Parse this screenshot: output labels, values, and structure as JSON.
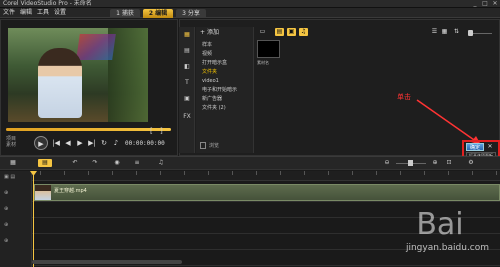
{
  "window": {
    "title": "Corel VideoStudio Pro - 未命名",
    "controls": [
      "_",
      "□",
      "✕"
    ]
  },
  "menu": [
    {
      "label": "文件"
    },
    {
      "label": "编辑"
    },
    {
      "label": "工具"
    },
    {
      "label": "设置"
    }
  ],
  "steps": [
    {
      "label": "1 捕获",
      "active": false
    },
    {
      "label": "2 编辑",
      "active": true
    },
    {
      "label": "3 分享",
      "active": false
    }
  ],
  "preview": {
    "project_label": "项目",
    "clip_label": "素材",
    "timecode": "00:00:00:00",
    "brackets": [
      "[",
      "]"
    ]
  },
  "library": {
    "add_label": "添加",
    "folders": [
      {
        "label": "样本",
        "active": false
      },
      {
        "label": "视频",
        "active": false
      },
      {
        "label": "打开暗示盒",
        "active": false
      },
      {
        "label": "文件夹",
        "active": true
      },
      {
        "label": "video1",
        "active": false
      },
      {
        "label": "电子和开始暗示",
        "active": false
      },
      {
        "label": "新广告器",
        "active": false
      },
      {
        "label": "文件夹 (2)",
        "active": false
      }
    ],
    "browse_label": "浏览",
    "thumb_label": "素材名"
  },
  "annotation": {
    "text": "单击",
    "color": "#ff3333"
  },
  "ok_button": {
    "label": "确定",
    "close": "✕",
    "tooltip": "打开选项面板"
  },
  "timeline": {
    "clip_name": "夏王穿越.mp4",
    "track_labels": [
      "▣ ▤",
      "⊕",
      "⊕",
      "⊕",
      "⊕"
    ]
  },
  "watermark": {
    "text": "jingyan.baidu.com",
    "logo": "Bai"
  }
}
